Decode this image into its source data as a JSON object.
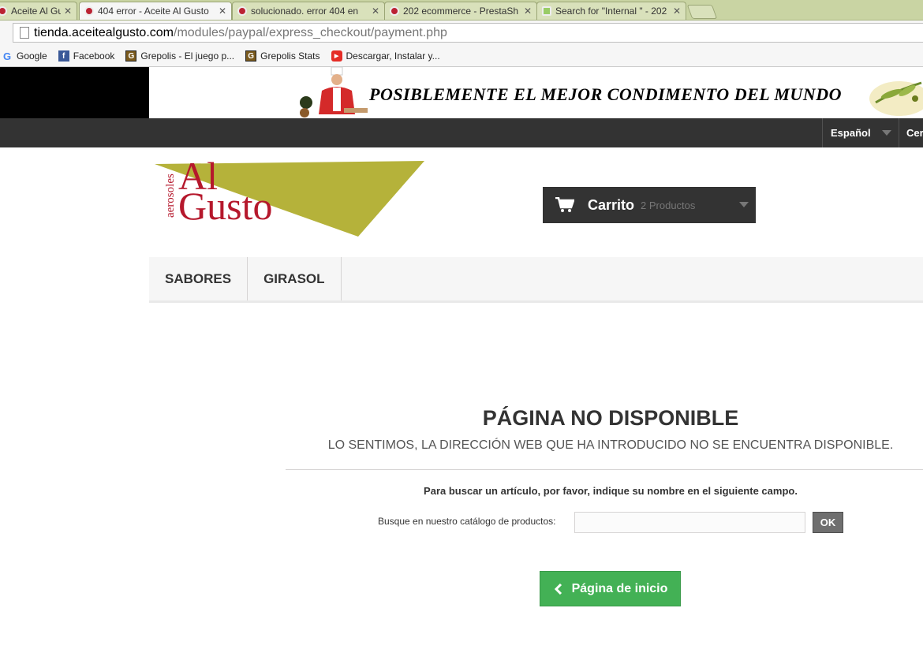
{
  "browser": {
    "tabs": [
      {
        "title": "Aceite Al Gusto",
        "active": false
      },
      {
        "title": "404 error - Aceite Al Gusto",
        "active": true
      },
      {
        "title": "solucionado. error 404 en",
        "active": false
      },
      {
        "title": "202 ecommerce - PrestaSh",
        "active": false
      },
      {
        "title": "Search for \"Internal \" - 202",
        "active": false
      }
    ],
    "close_glyph": "✕",
    "url_domain": "tienda.aceitealgusto.com",
    "url_path": "/modules/paypal/express_checkout/payment.php",
    "bookmarks": [
      {
        "label": "Google",
        "icon": "google-icon",
        "glyph": "G"
      },
      {
        "label": "Facebook",
        "icon": "facebook-icon",
        "glyph": "f"
      },
      {
        "label": "Grepolis - El juego p...",
        "icon": "grepolis-icon",
        "glyph": "G"
      },
      {
        "label": "Grepolis Stats",
        "icon": "grepolis-icon",
        "glyph": "G"
      },
      {
        "label": "Descargar, Instalar y...",
        "icon": "youtube-icon",
        "glyph": "▶"
      }
    ]
  },
  "banner": {
    "slogan": "POSIBLEMENTE EL MEJOR CONDIMENTO DEL MUNDO"
  },
  "topnav": {
    "language": "Español",
    "currency_partial": "Cer"
  },
  "logo": {
    "line1": "Al",
    "line2": "Gusto",
    "vertical": "aerosoles"
  },
  "cart": {
    "label": "Carrito",
    "count": "2 Productos"
  },
  "menu": {
    "items": [
      "SABORES",
      "GIRASOL"
    ]
  },
  "content": {
    "title": "PÁGINA NO DISPONIBLE",
    "subtitle": "LO SENTIMOS, LA DIRECCIÓN WEB QUE HA INTRODUCIDO NO SE ENCUENTRA DISPONIBLE.",
    "hint": "Para buscar un artículo, por favor, indique su nombre en el siguiente campo.",
    "search_label": "Busque en nuestro catálogo de productos:",
    "search_value": "",
    "ok_label": "OK",
    "home_label": "Página de inicio"
  },
  "colors": {
    "home_button": "#43b155",
    "navbar": "#333333",
    "logo_triangle": "#b5b23a",
    "logo_text": "#b5182c"
  }
}
